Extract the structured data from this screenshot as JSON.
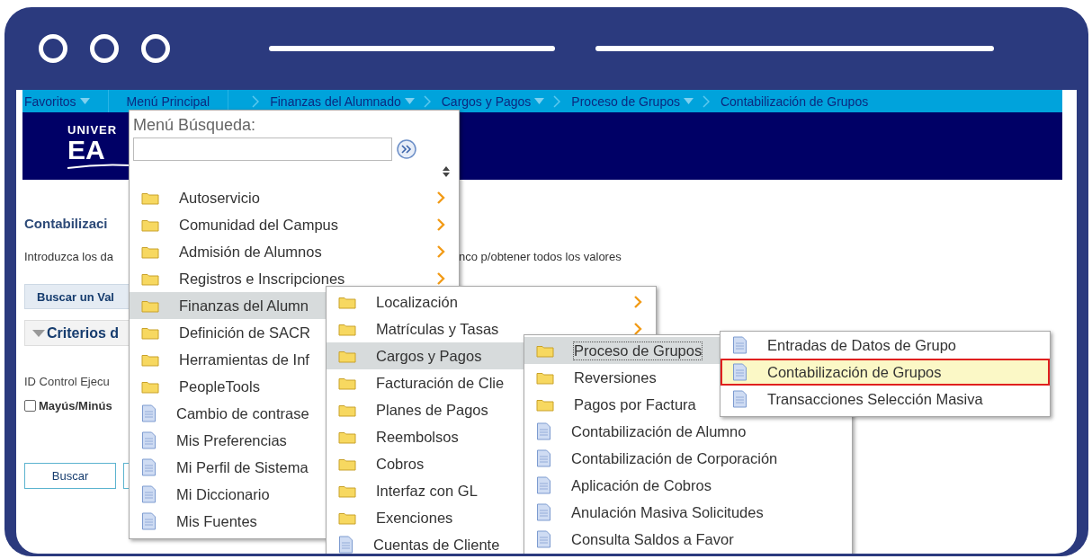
{
  "breadcrumb": [
    {
      "label": "Favoritos",
      "dropdown": true
    },
    {
      "label": "Menú Principal",
      "dropdown": false
    },
    {
      "label": "Finanzas del Alumnado",
      "dropdown": true
    },
    {
      "label": "Cargos y Pagos",
      "dropdown": true
    },
    {
      "label": "Proceso de Grupos",
      "dropdown": true
    },
    {
      "label": "Contabilización de Grupos",
      "dropdown": false
    }
  ],
  "logo": {
    "line_1": "UNIVER",
    "line_2": "EA"
  },
  "page": {
    "title": "Contabilizaci",
    "instructions": "Introduzca los da",
    "instructions_tail": "nco p/obtener todos los valores",
    "tab_label": "Buscar un Val",
    "section": {
      "label": "Criterios d",
      "expanded": true
    },
    "field_label": "ID Control Ejecu",
    "checkbox": {
      "label": "Mayús/Minús",
      "checked": false
    },
    "buttons": [
      "Buscar"
    ]
  },
  "menus": [
    {
      "search_label": "Menú Búsqueda:",
      "items": [
        {
          "label": "Autoservicio",
          "kind": "folder",
          "submenu": true,
          "selected": false
        },
        {
          "label": "Comunidad del Campus",
          "kind": "folder",
          "submenu": true,
          "selected": false
        },
        {
          "label": "Admisión de Alumnos",
          "kind": "folder",
          "submenu": true,
          "selected": false
        },
        {
          "label": "Registros e Inscripciones",
          "kind": "folder",
          "submenu": true,
          "selected": false
        },
        {
          "label": "Finanzas del Alumn",
          "kind": "folder",
          "selected": true
        },
        {
          "label": "Definición de SACR",
          "kind": "folder",
          "selected": false
        },
        {
          "label": "Herramientas de Inf",
          "kind": "folder",
          "selected": false
        },
        {
          "label": "PeopleTools",
          "kind": "folder",
          "selected": false
        },
        {
          "label": "Cambio de contrase",
          "kind": "page",
          "selected": false
        },
        {
          "label": "Mis Preferencias",
          "kind": "page",
          "selected": false
        },
        {
          "label": "Mi Perfil de Sistema",
          "kind": "page",
          "selected": false
        },
        {
          "label": "Mi Diccionario",
          "kind": "page",
          "selected": false
        },
        {
          "label": "Mis Fuentes",
          "kind": "page",
          "selected": false
        }
      ]
    },
    {
      "items": [
        {
          "label": "Localización",
          "kind": "folder",
          "submenu": true,
          "selected": false
        },
        {
          "label": "Matrículas y Tasas",
          "kind": "folder",
          "submenu": true,
          "selected": false
        },
        {
          "label": "Cargos y Pagos",
          "kind": "folder",
          "selected": true
        },
        {
          "label": "Facturación de Clie",
          "kind": "folder",
          "selected": false
        },
        {
          "label": "Planes de Pagos",
          "kind": "folder",
          "selected": false
        },
        {
          "label": "Reembolsos",
          "kind": "folder",
          "selected": false
        },
        {
          "label": "Cobros",
          "kind": "folder",
          "selected": false
        },
        {
          "label": "Interfaz con GL",
          "kind": "folder",
          "selected": false
        },
        {
          "label": "Exenciones",
          "kind": "folder",
          "selected": false
        },
        {
          "label": "Cuentas de Cliente",
          "kind": "page",
          "selected": false
        }
      ]
    },
    {
      "items": [
        {
          "label": "Proceso de Grupos",
          "kind": "folder",
          "selected": true
        },
        {
          "label": "Reversiones",
          "kind": "folder",
          "selected": false
        },
        {
          "label": "Pagos por Factura",
          "kind": "folder",
          "selected": false
        },
        {
          "label": "Contabilización de Alumno",
          "kind": "page",
          "submenu": false,
          "selected": false
        },
        {
          "label": "Contabilización de Corporación",
          "kind": "page",
          "submenu": false,
          "selected": false
        },
        {
          "label": "Aplicación de Cobros",
          "kind": "page",
          "submenu": false,
          "selected": false
        },
        {
          "label": "Anulación Masiva Solicitudes",
          "kind": "page",
          "submenu": false,
          "selected": false
        },
        {
          "label": "Consulta Saldos a Favor",
          "kind": "page",
          "submenu": false,
          "selected": false
        }
      ]
    },
    {
      "items": [
        {
          "label": "Entradas de Datos de Grupo",
          "kind": "page",
          "submenu": false,
          "selected": false,
          "outlined": false
        },
        {
          "label": "Contabilización de Grupos",
          "kind": "page",
          "submenu": false,
          "selected": true,
          "outlined": true
        },
        {
          "label": "Transacciones Selección Masiva",
          "kind": "page",
          "submenu": false,
          "selected": false,
          "outlined": false
        }
      ]
    }
  ]
}
